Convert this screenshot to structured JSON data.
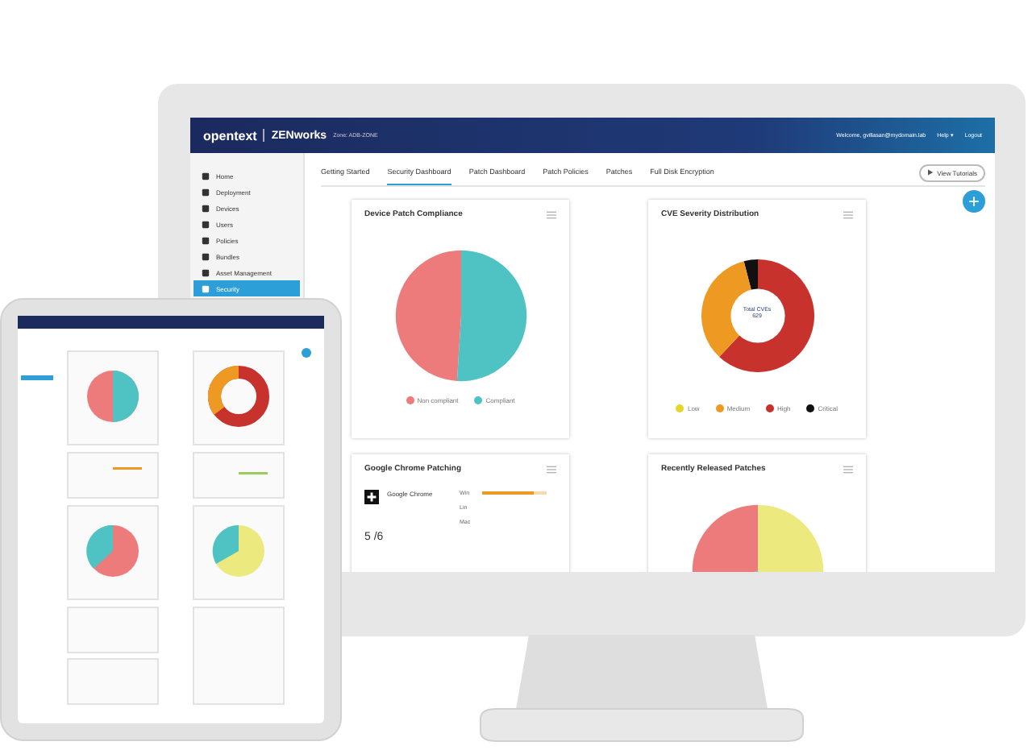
{
  "header": {
    "brand": "opentext",
    "product": "ZENworks",
    "zone": "Zone: ADB-ZONE",
    "welcome": "Welcome, gvillasan@mydomain.lab",
    "help": "Help ▾",
    "logout": "Logout"
  },
  "sidebar": {
    "items": [
      {
        "label": "Home",
        "selected": false
      },
      {
        "label": "Deployment",
        "selected": false
      },
      {
        "label": "Devices",
        "selected": false
      },
      {
        "label": "Users",
        "selected": false
      },
      {
        "label": "Policies",
        "selected": false
      },
      {
        "label": "Bundles",
        "selected": false
      },
      {
        "label": "Asset Management",
        "selected": false
      },
      {
        "label": "Security",
        "selected": true
      }
    ]
  },
  "tabs": [
    {
      "label": "Getting Started",
      "selected": false
    },
    {
      "label": "Security Dashboard",
      "selected": true
    },
    {
      "label": "Patch Dashboard",
      "selected": false
    },
    {
      "label": "Patch Policies",
      "selected": false
    },
    {
      "label": "Patches",
      "selected": false
    },
    {
      "label": "Full Disk Encryption",
      "selected": false
    }
  ],
  "tutorial_button": "View Tutorials",
  "add_button": "+",
  "cards": [
    {
      "kind": "pie",
      "title": "Device Patch Compliance",
      "legend": [
        {
          "label": "Non compliant",
          "color": "#ee7b7b"
        },
        {
          "label": "Compliant",
          "color": "#4fc3c3"
        }
      ]
    },
    {
      "kind": "donut",
      "title": "CVE Severity Distribution",
      "center": [
        "Total CVEs",
        "629"
      ],
      "legend": [
        {
          "label": "Low",
          "color": "#e6d62a"
        },
        {
          "label": "Medium",
          "color": "#ee9a22"
        },
        {
          "label": "High",
          "color": "#c8322d"
        },
        {
          "label": "Critical",
          "color": "#111111"
        }
      ]
    },
    {
      "kind": "app",
      "title": "Google Chrome Patching",
      "app": "Google Chrome",
      "rows": [
        {
          "label": "Win",
          "level": 0.8
        },
        {
          "label": "Lin"
        },
        {
          "label": "Mac"
        }
      ],
      "count": "5 /6"
    },
    {
      "kind": "partial_pie",
      "title": "Recently Released Patches"
    }
  ]
}
